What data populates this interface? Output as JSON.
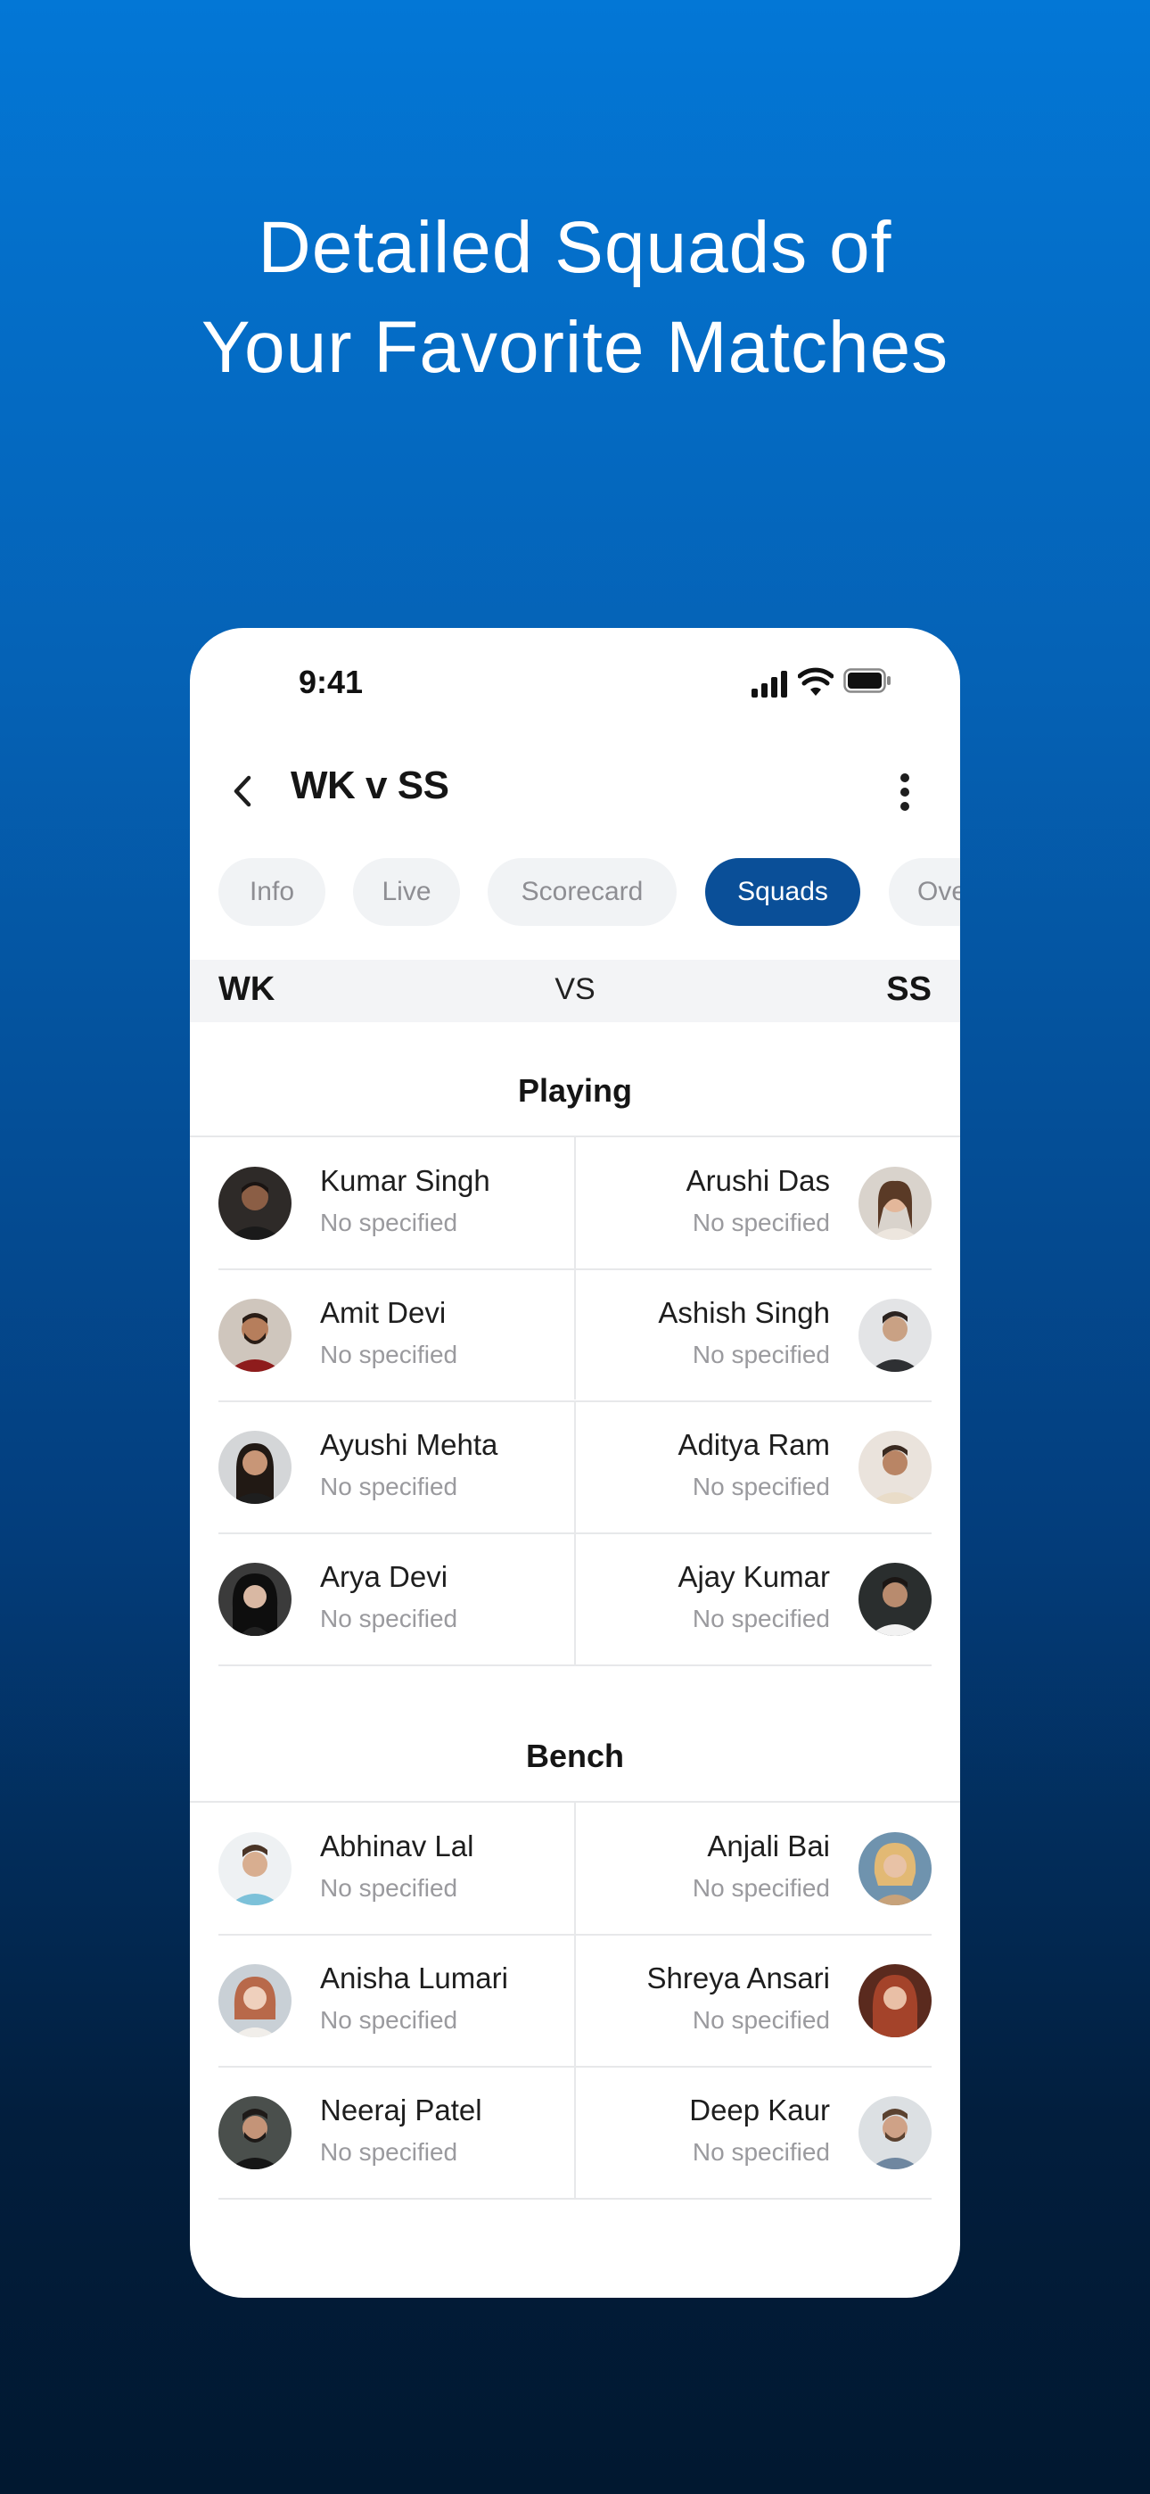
{
  "headline": {
    "line1": "Detailed Squads of",
    "line2": "Your Favorite Matches"
  },
  "status_bar": {
    "time": "9:41"
  },
  "header": {
    "title": "WK v SS"
  },
  "tabs": [
    {
      "label": "Info",
      "active": false
    },
    {
      "label": "Live",
      "active": false
    },
    {
      "label": "Scorecard",
      "active": false
    },
    {
      "label": "Squads",
      "active": true
    },
    {
      "label": "Ove",
      "active": false
    }
  ],
  "teams": {
    "left": "WK",
    "vs": "VS",
    "right": "SS"
  },
  "colors": {
    "accent": "#0A4F98",
    "gradient_top": "#0377D6",
    "gradient_bottom": "#011830"
  },
  "playing": {
    "title": "Playing",
    "rows": [
      {
        "left": {
          "name": "Kumar Singh",
          "role": "No specified"
        },
        "right": {
          "name": "Arushi Das",
          "role": "No specified"
        }
      },
      {
        "left": {
          "name": "Amit Devi",
          "role": "No specified"
        },
        "right": {
          "name": "Ashish Singh",
          "role": "No specified"
        }
      },
      {
        "left": {
          "name": "Ayushi Mehta",
          "role": "No specified"
        },
        "right": {
          "name": "Aditya Ram",
          "role": "No specified"
        }
      },
      {
        "left": {
          "name": "Arya Devi",
          "role": "No specified"
        },
        "right": {
          "name": "Ajay Kumar",
          "role": "No specified"
        }
      }
    ]
  },
  "bench": {
    "title": "Bench",
    "rows": [
      {
        "left": {
          "name": "Abhinav Lal",
          "role": "No specified"
        },
        "right": {
          "name": "Anjali Bai",
          "role": "No specified"
        }
      },
      {
        "left": {
          "name": "Anisha Lumari",
          "role": "No specified"
        },
        "right": {
          "name": "Shreya Ansari",
          "role": "No specified"
        }
      },
      {
        "left": {
          "name": "Neeraj Patel",
          "role": "No specified"
        },
        "right": {
          "name": "Deep Kaur",
          "role": "No specified"
        }
      }
    ]
  }
}
